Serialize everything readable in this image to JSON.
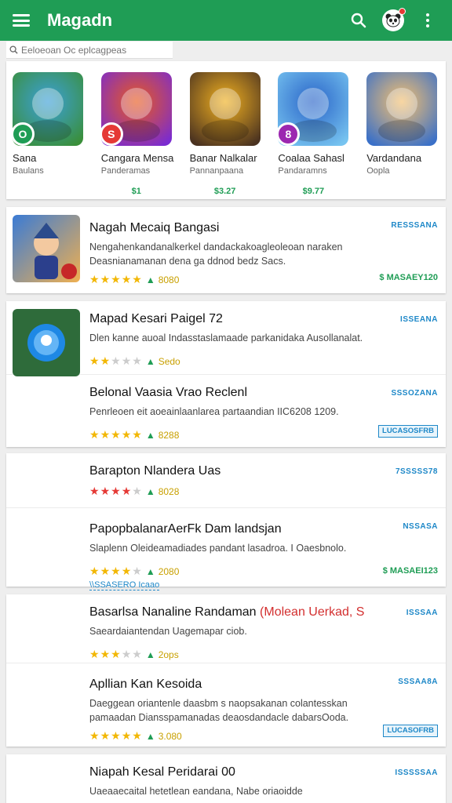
{
  "appbar": {
    "title": "Magadn",
    "menu_icon": "hamburger-icon",
    "search_icon": "search-icon",
    "profile_icon": "panda-avatar-icon",
    "overflow_icon": "kebab-icon",
    "color": "#1f9d55"
  },
  "search": {
    "placeholder": "Eeloeoan Oc eplcagpeas"
  },
  "featured": [
    {
      "name": "Sana",
      "sub": "Baulans",
      "price": "",
      "colors": [
        "#3ca0d8",
        "#3a8f3a"
      ],
      "badge": "O",
      "badge_color": "#1f9d55"
    },
    {
      "name": "Cangara Mensa",
      "sub": "Panderamas",
      "price": "$1",
      "colors": [
        "#e85a1f",
        "#7a2bd1"
      ],
      "badge": "S",
      "badge_color": "#e53935"
    },
    {
      "name": "Banar Nalkalar",
      "sub": "Pannanpaana",
      "price": "$3.27",
      "colors": [
        "#f0b020",
        "#4a3220"
      ],
      "badge": "",
      "badge_color": ""
    },
    {
      "name": "Coalaa Sahasl",
      "sub": "Pandaramns",
      "price": "$9.77",
      "colors": [
        "#2a64c8",
        "#77c4f0"
      ],
      "badge": "8",
      "badge_color": "#9c27b0"
    },
    {
      "name": "Vardandana",
      "sub": "Oopla",
      "price": "",
      "colors": [
        "#f4c070",
        "#3a70c8"
      ],
      "badge": "",
      "badge_color": ""
    }
  ],
  "list": [
    {
      "name": "Nagah Mecaiq Bangasi",
      "desc": "Nengahenkandanalkerkel dandackakoagleoleoan naraken Deasnianamanan dena ga ddnod bedz Sacs.",
      "stars": [
        1,
        1,
        1,
        1,
        1
      ],
      "star_style": "gold",
      "rating_text": "8080",
      "tag": "RESSSANA",
      "price": "$ MASAEY120",
      "button": "",
      "link": ""
    },
    {
      "name": "Mapad Kesari Paigel 72",
      "desc": "Dlen kanne auoal Indasstaslamaade parkanidaka Ausollanalat.",
      "stars": [
        1,
        0.5,
        0,
        0,
        0
      ],
      "star_style": "gold",
      "rating_text": "Sedo",
      "tag": "ISSEANA",
      "price": "",
      "button": "",
      "link": ""
    },
    {
      "name": "Belonal Vaasia Vrao Reclenl",
      "desc": "Penrleoen eit aoeainlaanlarea partaandian IIC6208 1209.",
      "stars": [
        1,
        1,
        1,
        1,
        0.5
      ],
      "star_style": "gold",
      "rating_text": "8288",
      "tag": "SSSOZANA",
      "price": "",
      "button": "LUCASOSFRB",
      "link": ""
    },
    {
      "name": "Barapton Nlandera Uas",
      "desc": "",
      "stars": [
        1,
        1,
        1,
        1,
        0
      ],
      "star_style": "red",
      "rating_text": "8028",
      "tag": "7SSSSS78",
      "price": "",
      "button": "",
      "link": ""
    },
    {
      "name": "PapopbalanarAerFk Dam landsjan",
      "desc": "Slaplenn Oleideamadiades pandant lasadroa. I Oaesbnolo.",
      "stars": [
        1,
        1,
        1,
        1,
        0
      ],
      "star_style": "gold",
      "rating_text": "2080",
      "tag": "NSSASA",
      "price": "$ MASAEI123",
      "button": "",
      "link": "\\\\SSASERO Icaao"
    },
    {
      "name": "Basarlsa Nanaline Randaman",
      "name_hot": "(Molean Uerkad, S",
      "desc": "Saeardaiantendan Uagemapar ciob.",
      "stars": [
        1,
        1,
        1,
        0,
        0
      ],
      "star_style": "gold",
      "rating_text": "2ops",
      "tag": "ISSSAA",
      "price": "",
      "button": "",
      "link": ""
    },
    {
      "name": "Apllian Kan Kesoida",
      "desc": "Daeggean oriantenle daasbm s naopsakanan colantesskan pamaadan Diansspamanadas deaosdandacle dabarsOoda.",
      "stars": [
        1,
        1,
        1,
        1,
        1
      ],
      "star_style": "gold",
      "rating_text": "3.080",
      "tag": "SSSAA8A",
      "price": "",
      "button": "LUCASOFRB",
      "link": ""
    },
    {
      "name": "Niapah Kesal Peridarai 00",
      "desc": "Uaeaaecaital hetetlean eandana, Nabe oriaoidde",
      "stars": [],
      "star_style": "gold",
      "rating_text": "",
      "tag": "ISSSSSAA",
      "price": "",
      "button": "",
      "link": ""
    }
  ]
}
